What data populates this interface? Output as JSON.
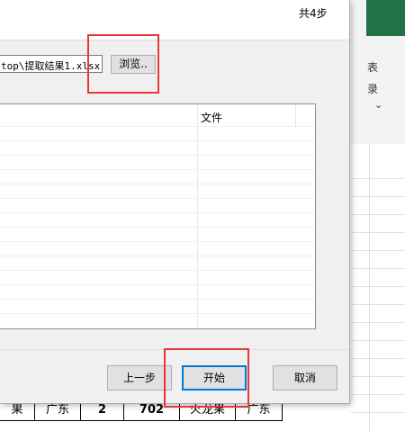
{
  "dialog": {
    "step_count": "共4步",
    "path_value": "top\\提取结果1.xlsx",
    "browse_label": "浏览..",
    "column_file": "文件",
    "buttons": {
      "prev": "上一步",
      "start": "开始",
      "cancel": "取消"
    }
  },
  "ribbon": {
    "item1": "表",
    "item2": "录",
    "item3": "⌄"
  },
  "sheet": {
    "cells": [
      "果",
      "广东",
      "2",
      "702",
      "火龙果",
      "广东"
    ]
  },
  "colors": {
    "highlight": "#e53935",
    "focus": "#0078d7",
    "excel_green": "#217346"
  }
}
